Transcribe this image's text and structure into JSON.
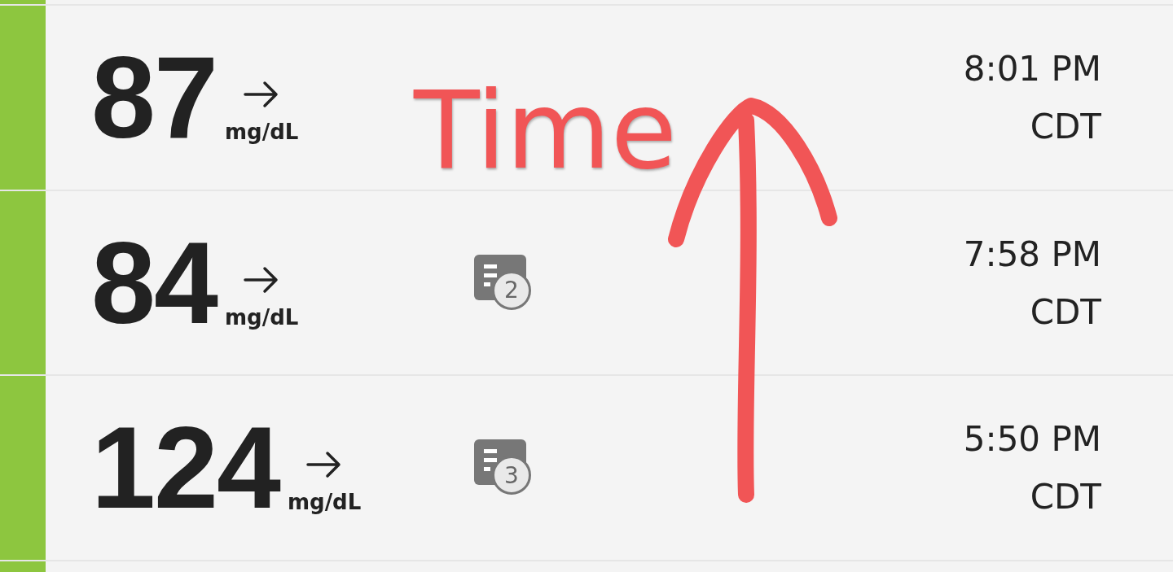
{
  "readings": [
    {
      "value": "87",
      "unit": "mg/dL",
      "kind": "steady",
      "color": "#8dc63f",
      "time": "8:01 PM",
      "zone": "CDT"
    },
    {
      "value": "84",
      "unit": "mg/dL",
      "kind": "steady",
      "color": "#8dc63f",
      "notes": "2",
      "time": "7:58 PM",
      "zone": "CDT"
    },
    {
      "value": "124",
      "unit": "mg/dL",
      "kind": "steady",
      "color": "#8dc63f",
      "notes": "3",
      "time": "5:50 PM",
      "zone": "CDT"
    }
  ],
  "annotation": {
    "text": "Time",
    "kind": "arrow-up"
  }
}
